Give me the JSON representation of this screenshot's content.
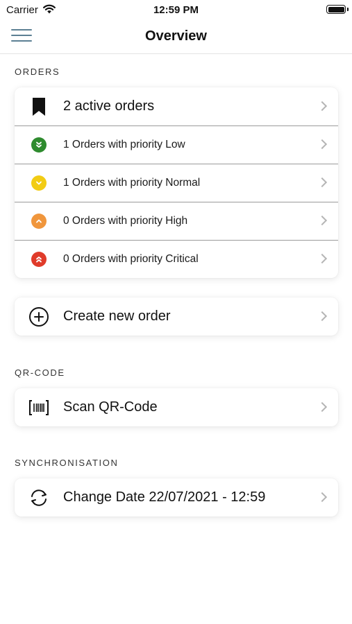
{
  "status_bar": {
    "carrier": "Carrier",
    "time": "12:59 PM"
  },
  "nav": {
    "title": "Overview"
  },
  "orders": {
    "section_title": "ORDERS",
    "active": "2 active orders",
    "priorities": [
      {
        "label": "1 Orders with priority Low",
        "color": "#2e8b2e",
        "icon": "chevrons-down-icon"
      },
      {
        "label": "1 Orders with priority Normal",
        "color": "#f2cc14",
        "icon": "chevron-down-icon"
      },
      {
        "label": "0 Orders with priority High",
        "color": "#f0963c",
        "icon": "chevron-up-icon"
      },
      {
        "label": "0 Orders with priority Critical",
        "color": "#e03b2a",
        "icon": "chevrons-up-icon"
      }
    ],
    "create": "Create new order"
  },
  "qr": {
    "section_title": "QR-CODE",
    "scan": "Scan QR-Code"
  },
  "sync": {
    "section_title": "SYNCHRONISATION",
    "change_date": "Change Date 22/07/2021 - 12:59"
  }
}
